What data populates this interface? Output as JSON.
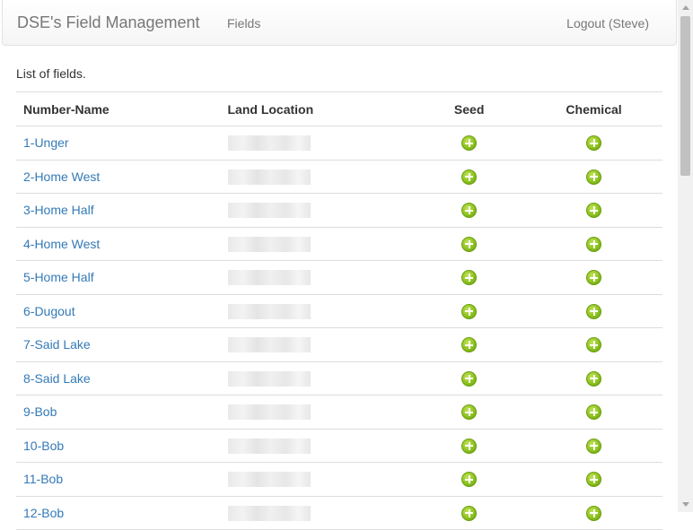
{
  "navbar": {
    "brand": "DSE's Field Management",
    "fields_link": "Fields",
    "logout_link": "Logout (Steve)"
  },
  "main": {
    "intro": "List of fields.",
    "table": {
      "headers": {
        "number_name": "Number-Name",
        "land_location": "Land Location",
        "seed": "Seed",
        "chemical": "Chemical"
      },
      "rows": [
        {
          "name": "1-Unger"
        },
        {
          "name": "2-Home West"
        },
        {
          "name": "3-Home Half"
        },
        {
          "name": "4-Home West"
        },
        {
          "name": "5-Home Half"
        },
        {
          "name": "6-Dugout"
        },
        {
          "name": "7-Said Lake"
        },
        {
          "name": "8-Said Lake"
        },
        {
          "name": "9-Bob"
        },
        {
          "name": "10-Bob"
        },
        {
          "name": "11-Bob"
        },
        {
          "name": "12-Bob"
        }
      ]
    }
  },
  "icons": {
    "seed": "add-circle-icon",
    "chemical": "add-circle-icon",
    "accent": "#8dc21f",
    "link_color": "#337ab7"
  }
}
